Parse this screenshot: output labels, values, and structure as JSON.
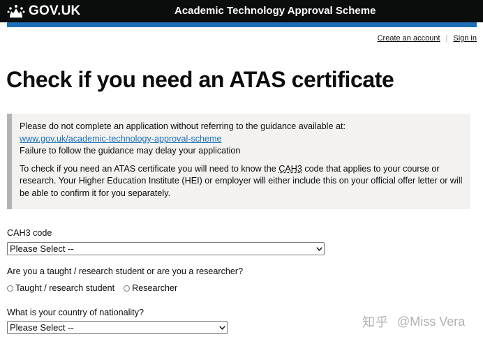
{
  "header": {
    "logo_text": "GOV.UK",
    "service_name": "Academic Technology Approval Scheme",
    "crown_icon": "crown-icon",
    "accent_bar_color": "#1d70b8"
  },
  "account": {
    "create_label": "Create an account",
    "separator": "|",
    "signin_label": "Sign in"
  },
  "page": {
    "title": "Check if you need an ATAS certificate"
  },
  "inset": {
    "line1": "Please do not complete an application without referring to the guidance available at:",
    "link": "www.gov.uk/academic-technology-approval-scheme",
    "line3": "Failure to follow the guidance may delay your application",
    "para2_before": "To check if you need an ATAS certificate you will need to know the ",
    "para2_abbr": "CAH3",
    "para2_after": " code that applies to your course or research. Your Higher Education Institute (HEI) or employer will either include this on your official offer letter or will be able to confirm it for you separately."
  },
  "form": {
    "cah3_label": "CAH3 code",
    "cah3_value": "Please Select --",
    "role_label": "Are you a taught / research student or are you a researcher?",
    "role_options": [
      "Taught / research student",
      "Researcher"
    ],
    "nationality_label": "What is your country of nationality?",
    "nationality_value": "Please Select --"
  },
  "watermark": {
    "logo": "知乎",
    "handle": "@Miss Vera"
  }
}
